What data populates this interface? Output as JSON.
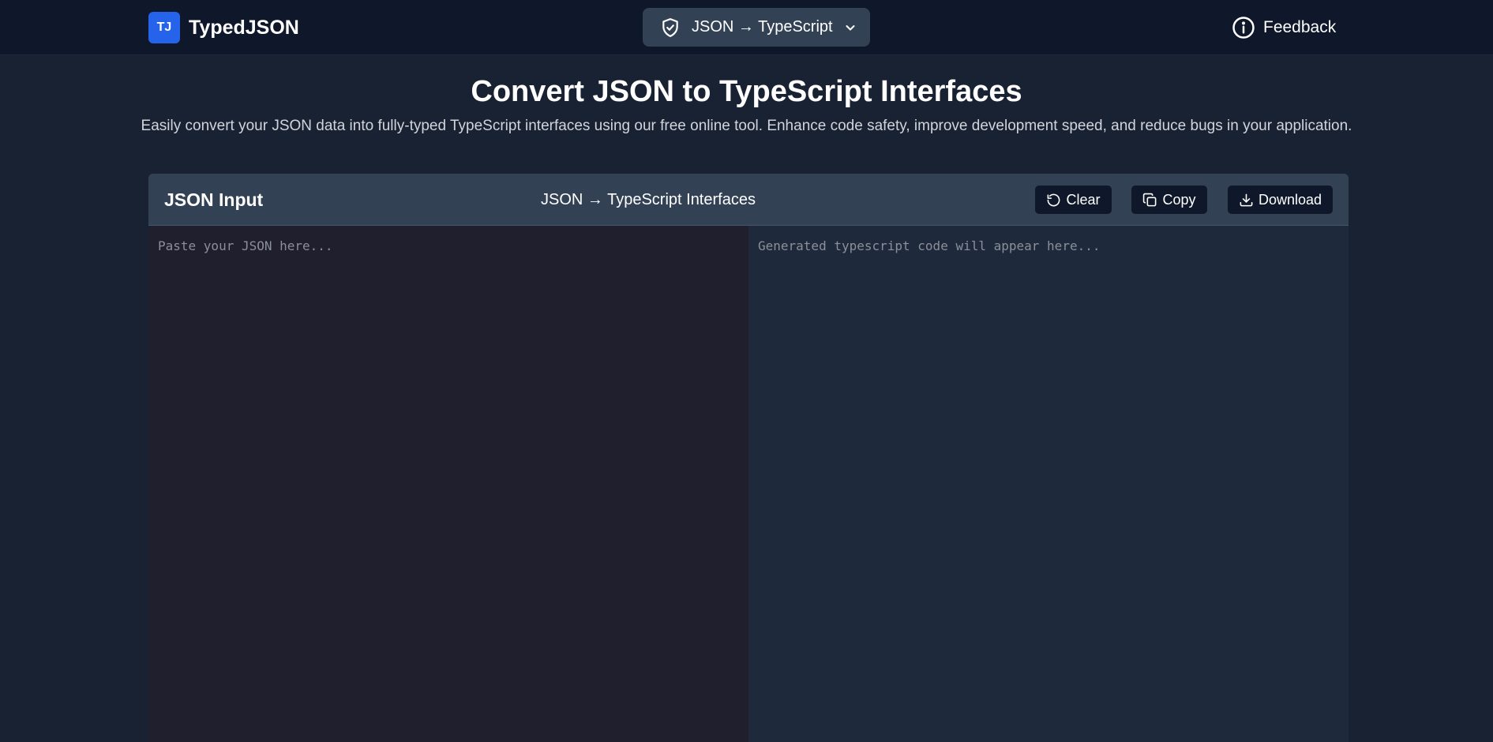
{
  "app": {
    "badge": "TJ",
    "name": "TypedJSON"
  },
  "mode_select": {
    "label": "JSON → TypeScript",
    "icon": "shield-check-icon"
  },
  "feedback": {
    "label": "Feedback",
    "icon": "info-circle-icon"
  },
  "hero": {
    "title": "Convert JSON to TypeScript Interfaces",
    "subtitle": "Easily convert your JSON data into fully-typed TypeScript interfaces using our free online tool. Enhance code safety, improve development speed, and reduce bugs in your application."
  },
  "editor": {
    "input_heading": "JSON Input",
    "output_heading": "JSON → TypeScript Interfaces",
    "input_value": "",
    "input_placeholder": "Paste your JSON here...",
    "output_placeholder": "Generated typescript code will appear here...",
    "buttons": {
      "clear": "Clear",
      "copy": "Copy",
      "download": "Download"
    }
  },
  "colors": {
    "brand": "#2563eb",
    "page_bg": "#192233",
    "topbar_bg": "#0f172a",
    "panel_header_bg": "#334155",
    "input_bg": "#1f1f2e",
    "output_bg": "#1e293b"
  }
}
